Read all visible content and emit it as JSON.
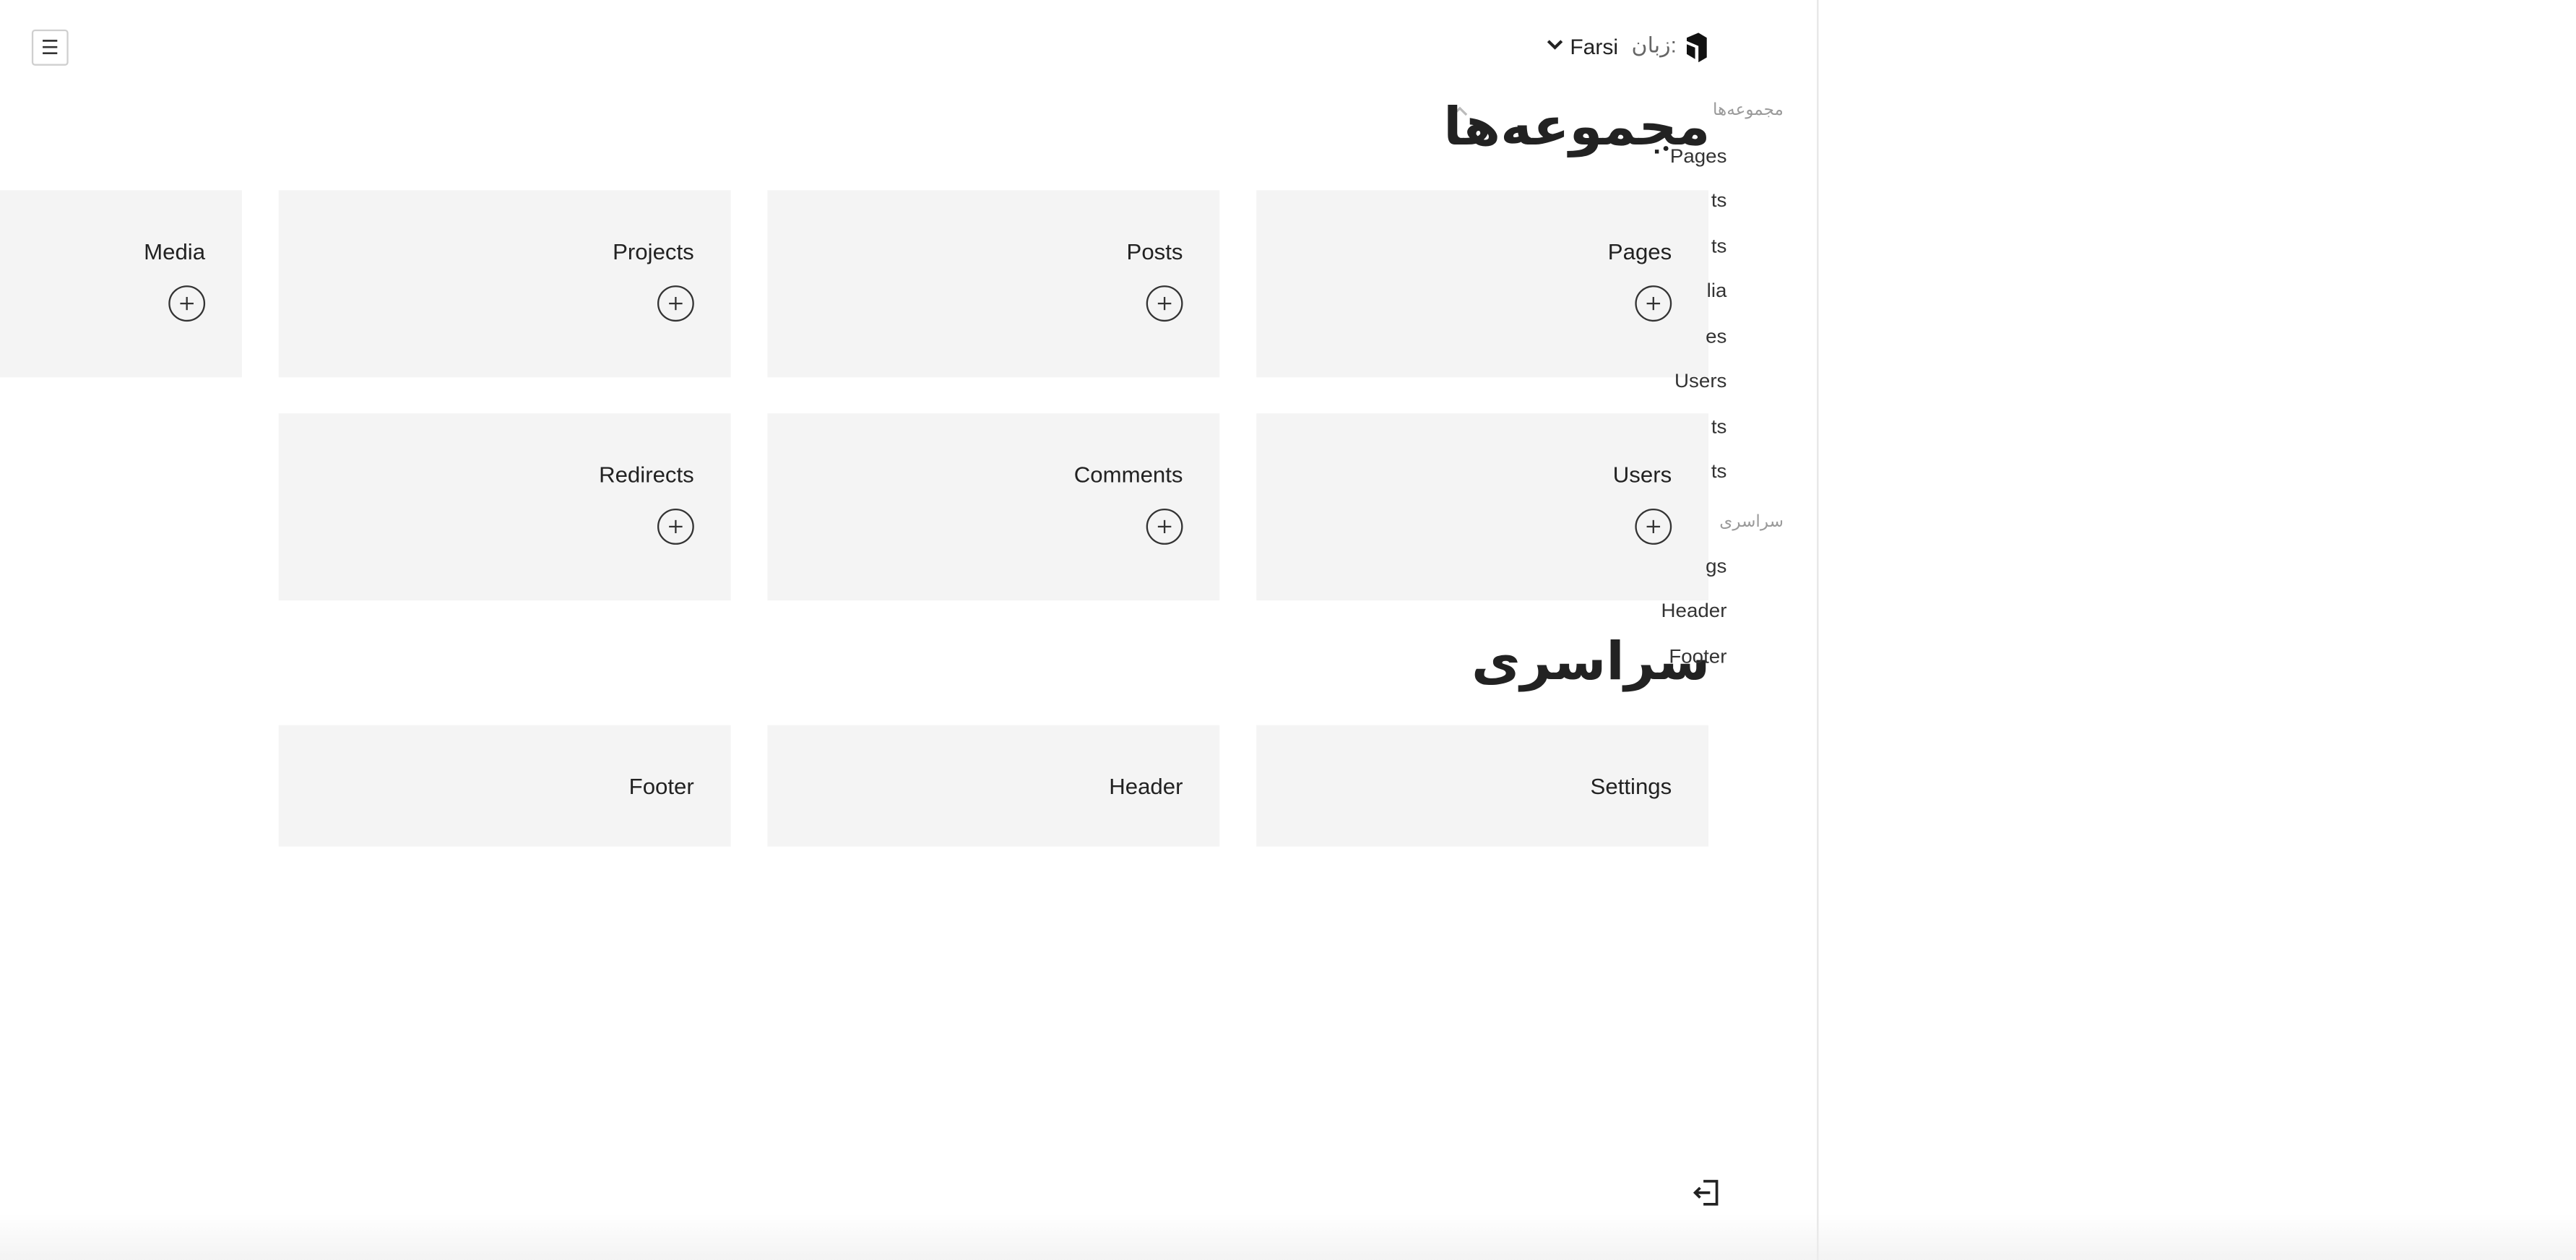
{
  "header": {
    "language_label": "زبان:",
    "language_value": "Farsi"
  },
  "sections": {
    "collections_title": "مجموعه‌ها",
    "global_title": "سراسری"
  },
  "sidebar": {
    "collections_label": "مجموعه‌ها",
    "global_label": "سراسری",
    "collection_items": [
      {
        "label": "Pages"
      },
      {
        "label": "ts"
      },
      {
        "label": "ts"
      },
      {
        "label": "lia"
      },
      {
        "label": "es"
      },
      {
        "label": "Users"
      },
      {
        "label": "ts"
      },
      {
        "label": "ts"
      }
    ],
    "global_items": [
      {
        "label": "gs"
      },
      {
        "label": "Header"
      },
      {
        "label": "Footer"
      }
    ]
  },
  "collections": [
    {
      "label": "Pages"
    },
    {
      "label": "Posts"
    },
    {
      "label": "Projects"
    },
    {
      "label": "Media"
    },
    {
      "label": "Users"
    },
    {
      "label": "Comments"
    },
    {
      "label": "Redirects"
    }
  ],
  "globals": [
    {
      "label": "Settings"
    },
    {
      "label": "Header"
    },
    {
      "label": "Footer"
    }
  ],
  "icons": {
    "menu": "hamburger-icon",
    "logo": "logo-icon",
    "language_dropdown": "chevron-down-icon",
    "collapse": "chevron-up-icon",
    "add": "plus-icon",
    "logout": "logout-icon"
  }
}
